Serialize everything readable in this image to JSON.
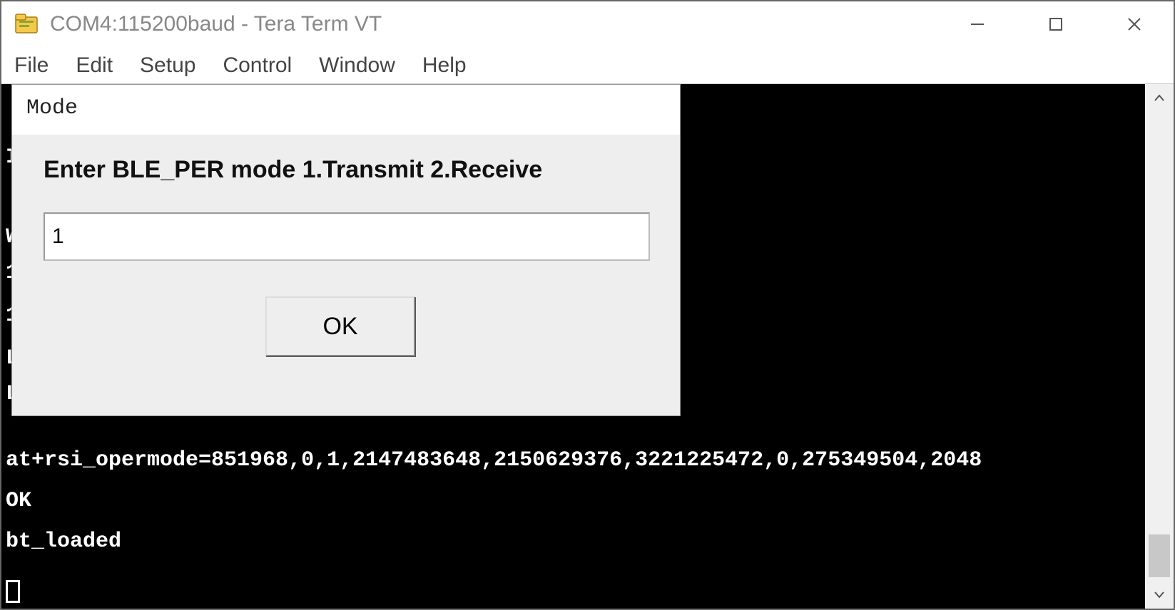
{
  "window": {
    "title": "COM4:115200baud - Tera Term VT"
  },
  "menu": {
    "items": [
      "File",
      "Edit",
      "Setup",
      "Control",
      "Window",
      "Help"
    ]
  },
  "dialog": {
    "title": "Mode",
    "prompt": "Enter BLE_PER mode 1.Transmit 2.Receive",
    "input_value": "1",
    "ok_label": "OK"
  },
  "terminal": {
    "left_glyphs": [
      "I",
      "W",
      "1",
      "1",
      "L",
      "L"
    ],
    "lines": [
      "at+rsi_opermode=851968,0,1,2147483648,2150629376,3221225472,0,275349504,2048",
      "OK",
      "bt_loaded"
    ]
  }
}
